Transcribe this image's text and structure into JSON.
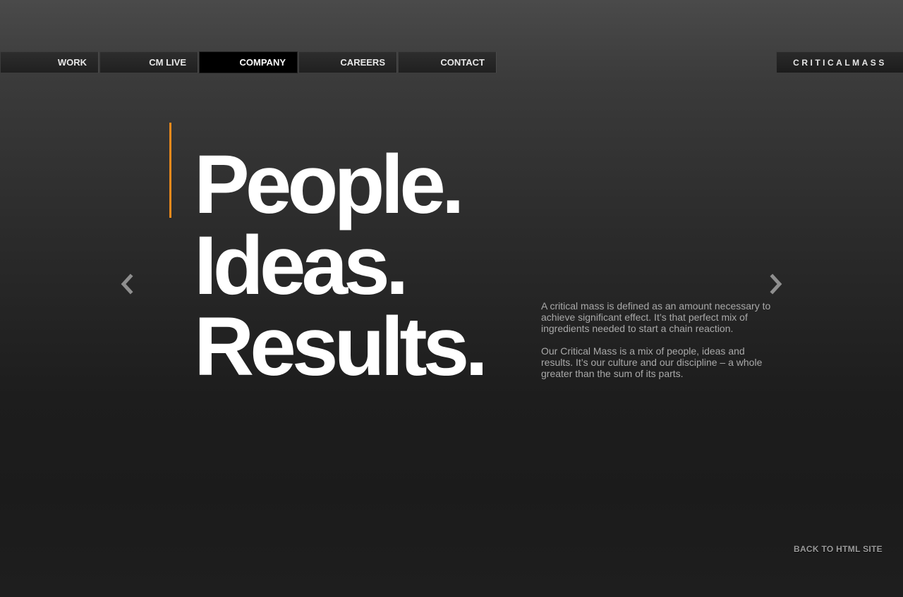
{
  "nav": {
    "items": [
      {
        "label": "WORK",
        "active": false
      },
      {
        "label": "CM LIVE",
        "active": false
      },
      {
        "label": "COMPANY",
        "active": true
      },
      {
        "label": "CAREERS",
        "active": false
      },
      {
        "label": "CONTACT",
        "active": false
      }
    ]
  },
  "logo": {
    "text": "CRITICALMASS"
  },
  "hero": {
    "lines": [
      "People.",
      "Ideas.",
      "Results."
    ],
    "accent_color": "#f08a1c"
  },
  "description": {
    "paragraphs": [
      "A critical mass is defined as an amount necessary to achieve significant effect. It’s that perfect mix of ingredients needed to start a chain reaction.",
      "Our Critical Mass is a mix of people, ideas and results. It’s our culture and our discipline – a whole greater than the sum of its parts."
    ]
  },
  "icons": {
    "prev": "chevron-left-icon",
    "next": "chevron-right-icon"
  },
  "footer": {
    "back_link": "BACK TO HTML SITE"
  }
}
